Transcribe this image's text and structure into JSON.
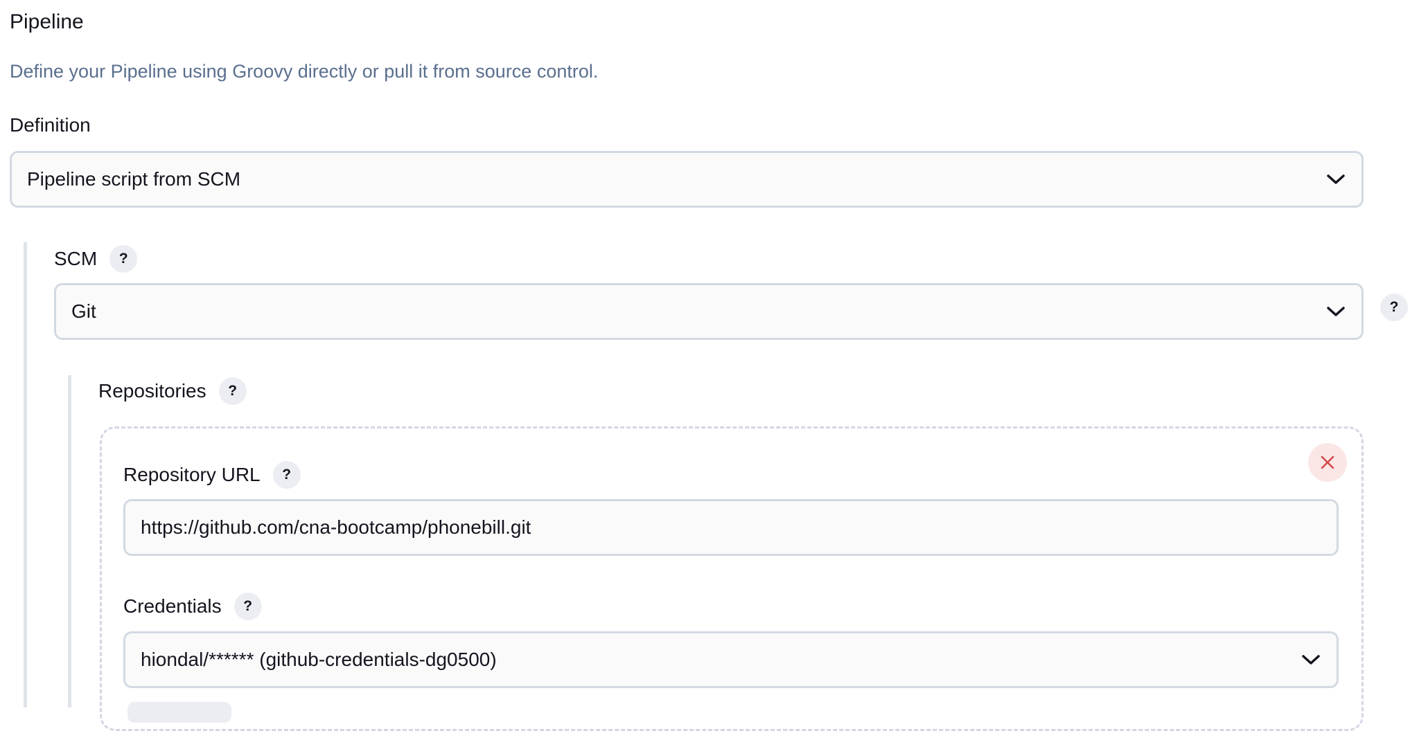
{
  "pipeline": {
    "title": "Pipeline",
    "description": "Define your Pipeline using Groovy directly or pull it from source control.",
    "definition": {
      "label": "Definition",
      "selected": "Pipeline script from SCM"
    }
  },
  "scm": {
    "label": "SCM",
    "help": "?",
    "selected": "Git",
    "side_help": "?"
  },
  "repositories": {
    "label": "Repositories",
    "help": "?",
    "repository_url": {
      "label": "Repository URL",
      "help": "?",
      "value": "https://github.com/cna-bootcamp/phonebill.git"
    },
    "credentials": {
      "label": "Credentials",
      "help": "?",
      "selected": "hiondal/****** (github-credentials-dg0500)"
    }
  },
  "icons": {
    "dropdown": "chevron-down-icon",
    "remove": "close-icon"
  },
  "colors": {
    "description_text": "#5a6f8e",
    "input_border": "#d3d9e2",
    "remove_icon": "#d24a4a",
    "remove_bg": "#fbe6e6"
  }
}
